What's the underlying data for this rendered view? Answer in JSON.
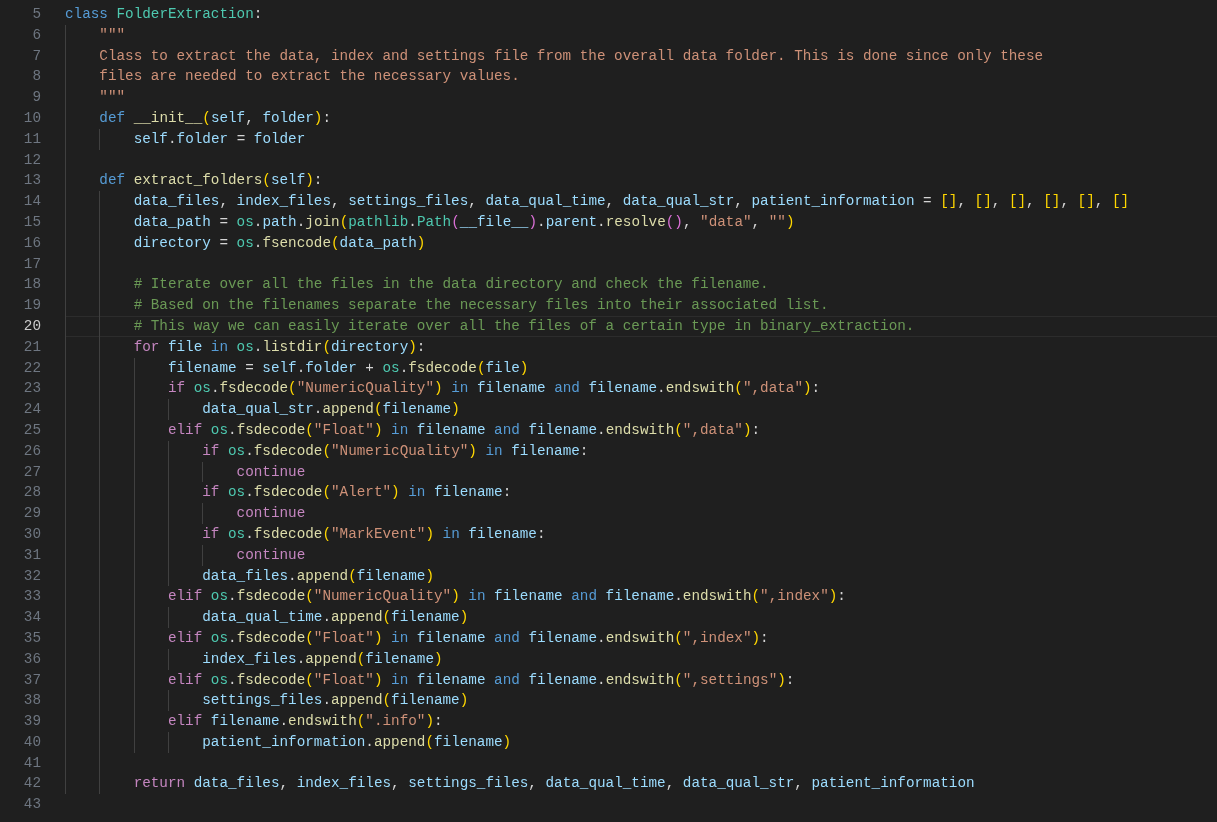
{
  "editor": {
    "lines": [
      {
        "number": "5",
        "selected": false,
        "tokens": [
          {
            "kind": "kw",
            "text": "class"
          },
          {
            "kind": "type",
            "text": " FolderExtraction"
          },
          {
            "kind": "op",
            "text": ":"
          }
        ]
      },
      {
        "number": "6",
        "selected": false,
        "tokens": [
          {
            "kind": "str",
            "text": "    \"\"\""
          }
        ]
      },
      {
        "number": "7",
        "selected": false,
        "tokens": [
          {
            "kind": "str",
            "text": "    Class to extract the data, index and settings file from the overall data folder. This is done since only these"
          }
        ]
      },
      {
        "number": "8",
        "selected": false,
        "tokens": [
          {
            "kind": "str",
            "text": "    files are needed to extract the necessary values."
          }
        ]
      },
      {
        "number": "9",
        "selected": false,
        "tokens": [
          {
            "kind": "str",
            "text": "    \"\"\""
          }
        ]
      },
      {
        "number": "10",
        "selected": false,
        "tokens": [
          {
            "kind": "kw",
            "text": "    def"
          },
          {
            "kind": "fn",
            "text": " __init__"
          },
          {
            "kind": "b1",
            "text": "("
          },
          {
            "kind": "var",
            "text": "self"
          },
          {
            "kind": "op",
            "text": ", "
          },
          {
            "kind": "var",
            "text": "folder"
          },
          {
            "kind": "b1",
            "text": ")"
          },
          {
            "kind": "op",
            "text": ":"
          }
        ]
      },
      {
        "number": "11",
        "selected": false,
        "tokens": [
          {
            "kind": "var",
            "text": "        self"
          },
          {
            "kind": "op",
            "text": "."
          },
          {
            "kind": "var",
            "text": "folder"
          },
          {
            "kind": "op",
            "text": " = "
          },
          {
            "kind": "var",
            "text": "folder"
          }
        ]
      },
      {
        "number": "12",
        "selected": false
      },
      {
        "number": "13",
        "selected": false,
        "tokens": [
          {
            "kind": "kw",
            "text": "    def"
          },
          {
            "kind": "fn",
            "text": " extract_folders"
          },
          {
            "kind": "b1",
            "text": "("
          },
          {
            "kind": "var",
            "text": "self"
          },
          {
            "kind": "b1",
            "text": ")"
          },
          {
            "kind": "op",
            "text": ":"
          }
        ]
      },
      {
        "number": "14",
        "selected": false,
        "tokens": [
          {
            "kind": "var",
            "text": "        data_files"
          },
          {
            "kind": "op",
            "text": ", "
          },
          {
            "kind": "var",
            "text": "index_files"
          },
          {
            "kind": "op",
            "text": ", "
          },
          {
            "kind": "var",
            "text": "settings_files"
          },
          {
            "kind": "op",
            "text": ", "
          },
          {
            "kind": "var",
            "text": "data_qual_time"
          },
          {
            "kind": "op",
            "text": ", "
          },
          {
            "kind": "var",
            "text": "data_qual_str"
          },
          {
            "kind": "op",
            "text": ", "
          },
          {
            "kind": "var",
            "text": "patient_information"
          },
          {
            "kind": "op",
            "text": " = "
          },
          {
            "kind": "b1",
            "text": "[]"
          },
          {
            "kind": "op",
            "text": ", "
          },
          {
            "kind": "b1",
            "text": "[]"
          },
          {
            "kind": "op",
            "text": ", "
          },
          {
            "kind": "b1",
            "text": "[]"
          },
          {
            "kind": "op",
            "text": ", "
          },
          {
            "kind": "b1",
            "text": "[]"
          },
          {
            "kind": "op",
            "text": ", "
          },
          {
            "kind": "b1",
            "text": "[]"
          },
          {
            "kind": "op",
            "text": ", "
          },
          {
            "kind": "b1",
            "text": "[]"
          }
        ]
      },
      {
        "number": "15",
        "selected": false,
        "tokens": [
          {
            "kind": "var",
            "text": "        data_path"
          },
          {
            "kind": "op",
            "text": " = "
          },
          {
            "kind": "type",
            "text": "os"
          },
          {
            "kind": "op",
            "text": "."
          },
          {
            "kind": "var",
            "text": "path"
          },
          {
            "kind": "op",
            "text": "."
          },
          {
            "kind": "fn",
            "text": "join"
          },
          {
            "kind": "b1",
            "text": "("
          },
          {
            "kind": "type",
            "text": "pathlib"
          },
          {
            "kind": "op",
            "text": "."
          },
          {
            "kind": "type",
            "text": "Path"
          },
          {
            "kind": "b2",
            "text": "("
          },
          {
            "kind": "var",
            "text": "__file__"
          },
          {
            "kind": "b2",
            "text": ")"
          },
          {
            "kind": "op",
            "text": "."
          },
          {
            "kind": "var",
            "text": "parent"
          },
          {
            "kind": "op",
            "text": "."
          },
          {
            "kind": "fn",
            "text": "resolve"
          },
          {
            "kind": "b2",
            "text": "()"
          },
          {
            "kind": "op",
            "text": ", "
          },
          {
            "kind": "str",
            "text": "\"data\""
          },
          {
            "kind": "op",
            "text": ", "
          },
          {
            "kind": "str",
            "text": "\"\""
          },
          {
            "kind": "b1",
            "text": ")"
          }
        ]
      },
      {
        "number": "16",
        "selected": false,
        "tokens": [
          {
            "kind": "var",
            "text": "        directory"
          },
          {
            "kind": "op",
            "text": " = "
          },
          {
            "kind": "type",
            "text": "os"
          },
          {
            "kind": "op",
            "text": "."
          },
          {
            "kind": "fn",
            "text": "fsencode"
          },
          {
            "kind": "b1",
            "text": "("
          },
          {
            "kind": "var",
            "text": "data_path"
          },
          {
            "kind": "b1",
            "text": ")"
          }
        ]
      },
      {
        "number": "17",
        "selected": false
      },
      {
        "number": "18",
        "selected": false,
        "tokens": [
          {
            "kind": "cmt",
            "text": "        # Iterate over all the files in the data directory and check the filename."
          }
        ]
      },
      {
        "number": "19",
        "selected": false,
        "tokens": [
          {
            "kind": "cmt",
            "text": "        # Based on the filenames separate the necessary files into their associated list."
          }
        ]
      },
      {
        "number": "20",
        "selected": true,
        "tokens": [
          {
            "kind": "cmt",
            "text": "        # This way we can easily iterate over all the files of a certain type in binary_extraction."
          }
        ]
      },
      {
        "number": "21",
        "selected": false,
        "tokens": [
          {
            "kind": "ctl",
            "text": "        for"
          },
          {
            "kind": "var",
            "text": " file"
          },
          {
            "kind": "kw",
            "text": " in"
          },
          {
            "kind": "type",
            "text": " os"
          },
          {
            "kind": "op",
            "text": "."
          },
          {
            "kind": "fn",
            "text": "listdir"
          },
          {
            "kind": "b1",
            "text": "("
          },
          {
            "kind": "var",
            "text": "directory"
          },
          {
            "kind": "b1",
            "text": ")"
          },
          {
            "kind": "op",
            "text": ":"
          }
        ]
      },
      {
        "number": "22",
        "selected": false,
        "tokens": [
          {
            "kind": "var",
            "text": "            filename"
          },
          {
            "kind": "op",
            "text": " = "
          },
          {
            "kind": "var",
            "text": "self"
          },
          {
            "kind": "op",
            "text": "."
          },
          {
            "kind": "var",
            "text": "folder"
          },
          {
            "kind": "op",
            "text": " + "
          },
          {
            "kind": "type",
            "text": "os"
          },
          {
            "kind": "op",
            "text": "."
          },
          {
            "kind": "fn",
            "text": "fsdecode"
          },
          {
            "kind": "b1",
            "text": "("
          },
          {
            "kind": "var",
            "text": "file"
          },
          {
            "kind": "b1",
            "text": ")"
          }
        ]
      },
      {
        "number": "23",
        "selected": false,
        "tokens": [
          {
            "kind": "ctl",
            "text": "            if"
          },
          {
            "kind": "type",
            "text": " os"
          },
          {
            "kind": "op",
            "text": "."
          },
          {
            "kind": "fn",
            "text": "fsdecode"
          },
          {
            "kind": "b1",
            "text": "("
          },
          {
            "kind": "str",
            "text": "\"NumericQuality\""
          },
          {
            "kind": "b1",
            "text": ")"
          },
          {
            "kind": "kw",
            "text": " in"
          },
          {
            "kind": "var",
            "text": " filename"
          },
          {
            "kind": "kw",
            "text": " and"
          },
          {
            "kind": "var",
            "text": " filename"
          },
          {
            "kind": "op",
            "text": "."
          },
          {
            "kind": "fn",
            "text": "endswith"
          },
          {
            "kind": "b1",
            "text": "("
          },
          {
            "kind": "str",
            "text": "\",data\""
          },
          {
            "kind": "b1",
            "text": ")"
          },
          {
            "kind": "op",
            "text": ":"
          }
        ]
      },
      {
        "number": "24",
        "selected": false,
        "tokens": [
          {
            "kind": "var",
            "text": "                data_qual_str"
          },
          {
            "kind": "op",
            "text": "."
          },
          {
            "kind": "fn",
            "text": "append"
          },
          {
            "kind": "b1",
            "text": "("
          },
          {
            "kind": "var",
            "text": "filename"
          },
          {
            "kind": "b1",
            "text": ")"
          }
        ]
      },
      {
        "number": "25",
        "selected": false,
        "tokens": [
          {
            "kind": "ctl",
            "text": "            elif"
          },
          {
            "kind": "type",
            "text": " os"
          },
          {
            "kind": "op",
            "text": "."
          },
          {
            "kind": "fn",
            "text": "fsdecode"
          },
          {
            "kind": "b1",
            "text": "("
          },
          {
            "kind": "str",
            "text": "\"Float\""
          },
          {
            "kind": "b1",
            "text": ")"
          },
          {
            "kind": "kw",
            "text": " in"
          },
          {
            "kind": "var",
            "text": " filename"
          },
          {
            "kind": "kw",
            "text": " and"
          },
          {
            "kind": "var",
            "text": " filename"
          },
          {
            "kind": "op",
            "text": "."
          },
          {
            "kind": "fn",
            "text": "endswith"
          },
          {
            "kind": "b1",
            "text": "("
          },
          {
            "kind": "str",
            "text": "\",data\""
          },
          {
            "kind": "b1",
            "text": ")"
          },
          {
            "kind": "op",
            "text": ":"
          }
        ]
      },
      {
        "number": "26",
        "selected": false,
        "tokens": [
          {
            "kind": "ctl",
            "text": "                if"
          },
          {
            "kind": "type",
            "text": " os"
          },
          {
            "kind": "op",
            "text": "."
          },
          {
            "kind": "fn",
            "text": "fsdecode"
          },
          {
            "kind": "b1",
            "text": "("
          },
          {
            "kind": "str",
            "text": "\"NumericQuality\""
          },
          {
            "kind": "b1",
            "text": ")"
          },
          {
            "kind": "kw",
            "text": " in"
          },
          {
            "kind": "var",
            "text": " filename"
          },
          {
            "kind": "op",
            "text": ":"
          }
        ]
      },
      {
        "number": "27",
        "selected": false,
        "tokens": [
          {
            "kind": "ctl",
            "text": "                    continue"
          }
        ]
      },
      {
        "number": "28",
        "selected": false,
        "tokens": [
          {
            "kind": "ctl",
            "text": "                if"
          },
          {
            "kind": "type",
            "text": " os"
          },
          {
            "kind": "op",
            "text": "."
          },
          {
            "kind": "fn",
            "text": "fsdecode"
          },
          {
            "kind": "b1",
            "text": "("
          },
          {
            "kind": "str",
            "text": "\"Alert\""
          },
          {
            "kind": "b1",
            "text": ")"
          },
          {
            "kind": "kw",
            "text": " in"
          },
          {
            "kind": "var",
            "text": " filename"
          },
          {
            "kind": "op",
            "text": ":"
          }
        ]
      },
      {
        "number": "29",
        "selected": false,
        "tokens": [
          {
            "kind": "ctl",
            "text": "                    continue"
          }
        ]
      },
      {
        "number": "30",
        "selected": false,
        "tokens": [
          {
            "kind": "ctl",
            "text": "                if"
          },
          {
            "kind": "type",
            "text": " os"
          },
          {
            "kind": "op",
            "text": "."
          },
          {
            "kind": "fn",
            "text": "fsdecode"
          },
          {
            "kind": "b1",
            "text": "("
          },
          {
            "kind": "str",
            "text": "\"MarkEvent\""
          },
          {
            "kind": "b1",
            "text": ")"
          },
          {
            "kind": "kw",
            "text": " in"
          },
          {
            "kind": "var",
            "text": " filename"
          },
          {
            "kind": "op",
            "text": ":"
          }
        ]
      },
      {
        "number": "31",
        "selected": false,
        "tokens": [
          {
            "kind": "ctl",
            "text": "                    continue"
          }
        ]
      },
      {
        "number": "32",
        "selected": false,
        "tokens": [
          {
            "kind": "var",
            "text": "                data_files"
          },
          {
            "kind": "op",
            "text": "."
          },
          {
            "kind": "fn",
            "text": "append"
          },
          {
            "kind": "b1",
            "text": "("
          },
          {
            "kind": "var",
            "text": "filename"
          },
          {
            "kind": "b1",
            "text": ")"
          }
        ]
      },
      {
        "number": "33",
        "selected": false,
        "tokens": [
          {
            "kind": "ctl",
            "text": "            elif"
          },
          {
            "kind": "type",
            "text": " os"
          },
          {
            "kind": "op",
            "text": "."
          },
          {
            "kind": "fn",
            "text": "fsdecode"
          },
          {
            "kind": "b1",
            "text": "("
          },
          {
            "kind": "str",
            "text": "\"NumericQuality\""
          },
          {
            "kind": "b1",
            "text": ")"
          },
          {
            "kind": "kw",
            "text": " in"
          },
          {
            "kind": "var",
            "text": " filename"
          },
          {
            "kind": "kw",
            "text": " and"
          },
          {
            "kind": "var",
            "text": " filename"
          },
          {
            "kind": "op",
            "text": "."
          },
          {
            "kind": "fn",
            "text": "endswith"
          },
          {
            "kind": "b1",
            "text": "("
          },
          {
            "kind": "str",
            "text": "\",index\""
          },
          {
            "kind": "b1",
            "text": ")"
          },
          {
            "kind": "op",
            "text": ":"
          }
        ]
      },
      {
        "number": "34",
        "selected": false,
        "tokens": [
          {
            "kind": "var",
            "text": "                data_qual_time"
          },
          {
            "kind": "op",
            "text": "."
          },
          {
            "kind": "fn",
            "text": "append"
          },
          {
            "kind": "b1",
            "text": "("
          },
          {
            "kind": "var",
            "text": "filename"
          },
          {
            "kind": "b1",
            "text": ")"
          }
        ]
      },
      {
        "number": "35",
        "selected": false,
        "tokens": [
          {
            "kind": "ctl",
            "text": "            elif"
          },
          {
            "kind": "type",
            "text": " os"
          },
          {
            "kind": "op",
            "text": "."
          },
          {
            "kind": "fn",
            "text": "fsdecode"
          },
          {
            "kind": "b1",
            "text": "("
          },
          {
            "kind": "str",
            "text": "\"Float\""
          },
          {
            "kind": "b1",
            "text": ")"
          },
          {
            "kind": "kw",
            "text": " in"
          },
          {
            "kind": "var",
            "text": " filename"
          },
          {
            "kind": "kw",
            "text": " and"
          },
          {
            "kind": "var",
            "text": " filename"
          },
          {
            "kind": "op",
            "text": "."
          },
          {
            "kind": "fn",
            "text": "endswith"
          },
          {
            "kind": "b1",
            "text": "("
          },
          {
            "kind": "str",
            "text": "\",index\""
          },
          {
            "kind": "b1",
            "text": ")"
          },
          {
            "kind": "op",
            "text": ":"
          }
        ]
      },
      {
        "number": "36",
        "selected": false,
        "tokens": [
          {
            "kind": "var",
            "text": "                index_files"
          },
          {
            "kind": "op",
            "text": "."
          },
          {
            "kind": "fn",
            "text": "append"
          },
          {
            "kind": "b1",
            "text": "("
          },
          {
            "kind": "var",
            "text": "filename"
          },
          {
            "kind": "b1",
            "text": ")"
          }
        ]
      },
      {
        "number": "37",
        "selected": false,
        "tokens": [
          {
            "kind": "ctl",
            "text": "            elif"
          },
          {
            "kind": "type",
            "text": " os"
          },
          {
            "kind": "op",
            "text": "."
          },
          {
            "kind": "fn",
            "text": "fsdecode"
          },
          {
            "kind": "b1",
            "text": "("
          },
          {
            "kind": "str",
            "text": "\"Float\""
          },
          {
            "kind": "b1",
            "text": ")"
          },
          {
            "kind": "kw",
            "text": " in"
          },
          {
            "kind": "var",
            "text": " filename"
          },
          {
            "kind": "kw",
            "text": " and"
          },
          {
            "kind": "var",
            "text": " filename"
          },
          {
            "kind": "op",
            "text": "."
          },
          {
            "kind": "fn",
            "text": "endswith"
          },
          {
            "kind": "b1",
            "text": "("
          },
          {
            "kind": "str",
            "text": "\",settings\""
          },
          {
            "kind": "b1",
            "text": ")"
          },
          {
            "kind": "op",
            "text": ":"
          }
        ]
      },
      {
        "number": "38",
        "selected": false,
        "tokens": [
          {
            "kind": "var",
            "text": "                settings_files"
          },
          {
            "kind": "op",
            "text": "."
          },
          {
            "kind": "fn",
            "text": "append"
          },
          {
            "kind": "b1",
            "text": "("
          },
          {
            "kind": "var",
            "text": "filename"
          },
          {
            "kind": "b1",
            "text": ")"
          }
        ]
      },
      {
        "number": "39",
        "selected": false,
        "tokens": [
          {
            "kind": "ctl",
            "text": "            elif"
          },
          {
            "kind": "var",
            "text": " filename"
          },
          {
            "kind": "op",
            "text": "."
          },
          {
            "kind": "fn",
            "text": "endswith"
          },
          {
            "kind": "b1",
            "text": "("
          },
          {
            "kind": "str",
            "text": "\".info\""
          },
          {
            "kind": "b1",
            "text": ")"
          },
          {
            "kind": "op",
            "text": ":"
          }
        ]
      },
      {
        "number": "40",
        "selected": false,
        "tokens": [
          {
            "kind": "var",
            "text": "                patient_information"
          },
          {
            "kind": "op",
            "text": "."
          },
          {
            "kind": "fn",
            "text": "append"
          },
          {
            "kind": "b1",
            "text": "("
          },
          {
            "kind": "var",
            "text": "filename"
          },
          {
            "kind": "b1",
            "text": ")"
          }
        ]
      },
      {
        "number": "41",
        "selected": false
      },
      {
        "number": "42",
        "selected": false,
        "tokens": [
          {
            "kind": "ctl",
            "text": "        return"
          },
          {
            "kind": "var",
            "text": " data_files"
          },
          {
            "kind": "op",
            "text": ", "
          },
          {
            "kind": "var",
            "text": "index_files"
          },
          {
            "kind": "op",
            "text": ", "
          },
          {
            "kind": "var",
            "text": "settings_files"
          },
          {
            "kind": "op",
            "text": ", "
          },
          {
            "kind": "var",
            "text": "data_qual_time"
          },
          {
            "kind": "op",
            "text": ", "
          },
          {
            "kind": "var",
            "text": "data_qual_str"
          },
          {
            "kind": "op",
            "text": ", "
          },
          {
            "kind": "var",
            "text": "patient_information"
          }
        ]
      },
      {
        "number": "43",
        "selected": false
      }
    ]
  }
}
